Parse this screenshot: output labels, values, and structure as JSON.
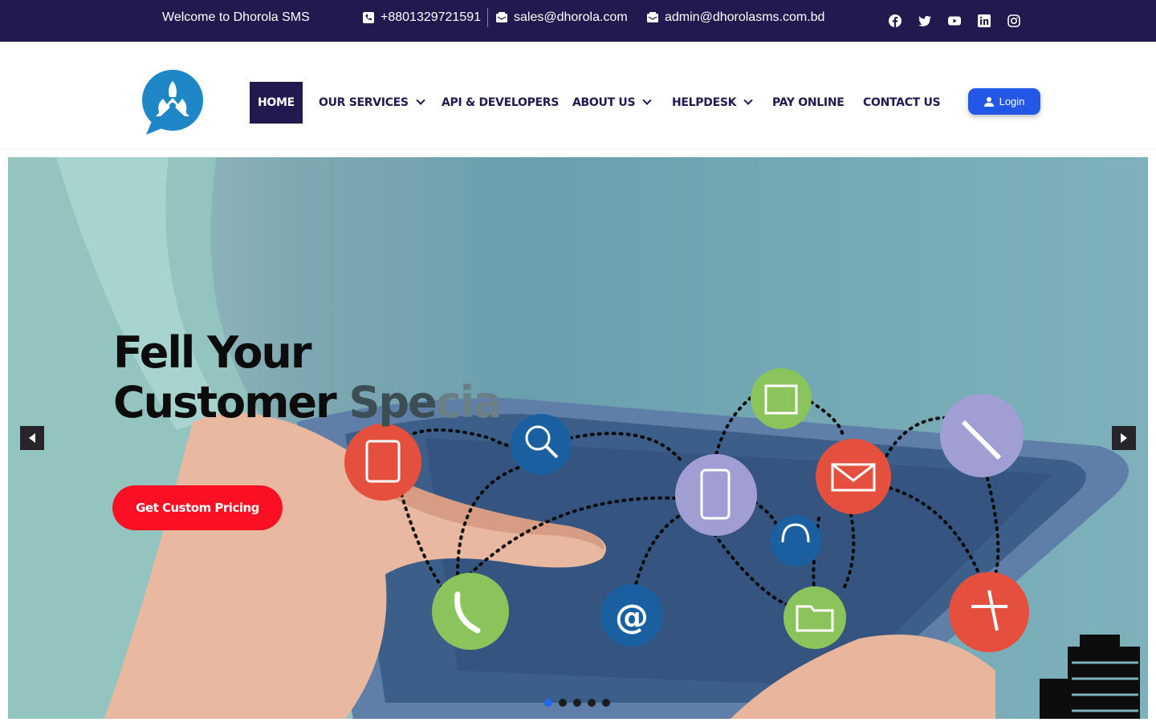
{
  "topbar": {
    "welcome": "Welcome to Dhorola SMS",
    "phone": "+8801329721591",
    "email_sales": "sales@dhorola.com",
    "email_admin": "admin@dhorolasms.com.bd",
    "socials": [
      "facebook-icon",
      "twitter-icon",
      "youtube-icon",
      "linkedin-icon",
      "instagram-icon"
    ],
    "bg_color": "#211a4f"
  },
  "nav": {
    "home": "HOME",
    "services": "OUR SERVICES",
    "api": "API & DEVELOPERS",
    "about": "ABOUT US",
    "helpdesk": "HELPDESK",
    "pay": "PAY ONLINE",
    "contact": "CONTACT US",
    "login": "Login"
  },
  "hero": {
    "title_line1": "Fell Your",
    "title_line2_a": "Customer ",
    "title_line2_b": "Spe",
    "title_line2_c": "cia",
    "cta": "Get Custom Pricing",
    "cta_color": "#fb1023",
    "slides_total": 5,
    "slide_active": 1
  }
}
